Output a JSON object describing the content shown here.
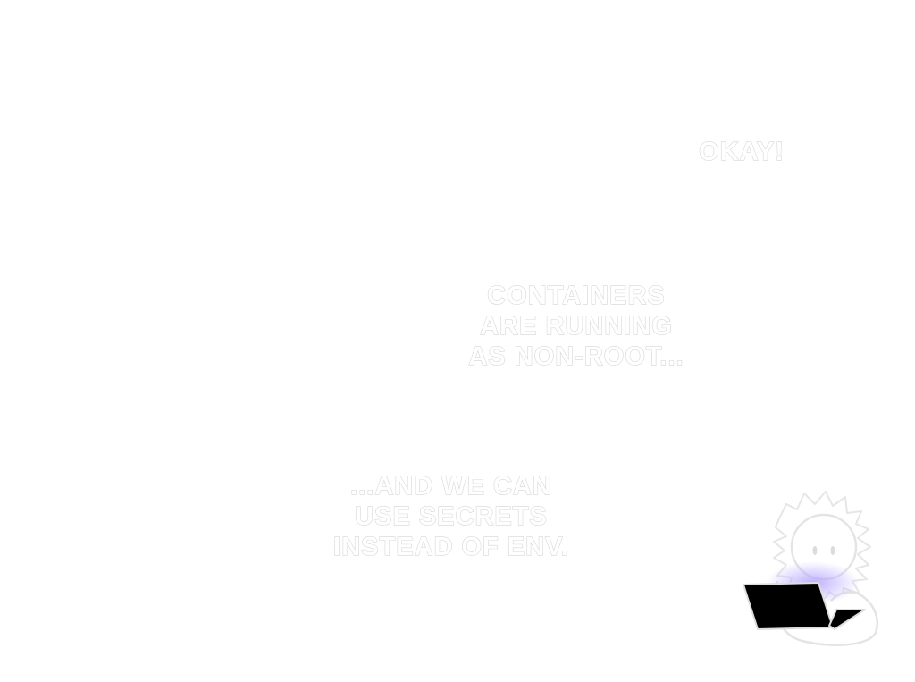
{
  "captions": {
    "okay": [
      "OKAY!"
    ],
    "containers": [
      "CONTAINERS",
      "ARE RUNNING",
      "AS NON-ROOT..."
    ],
    "secrets": [
      "...AND WE CAN",
      "USE SECRETS",
      "INSTEAD OF ENV."
    ]
  },
  "colors": {
    "background": "#ffffff",
    "caption_outline": "#d6d6d6",
    "character_outline": "#e4e4e4",
    "screen_glow": "#b7a7ff",
    "laptop": "#000000"
  },
  "icons": {
    "character": "spiky-haired-character-icon",
    "laptop": "laptop-icon"
  }
}
